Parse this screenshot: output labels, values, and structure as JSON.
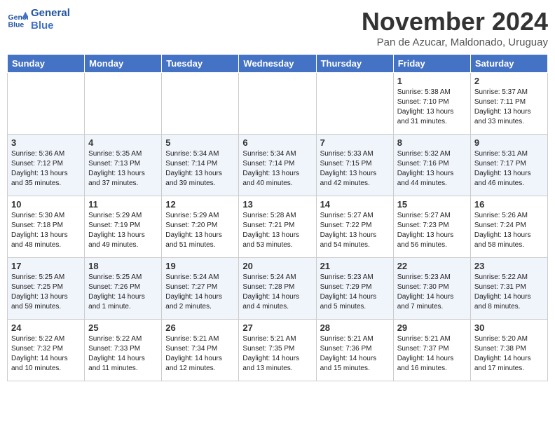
{
  "logo": {
    "text_general": "General",
    "text_blue": "Blue"
  },
  "header": {
    "month_title": "November 2024",
    "location": "Pan de Azucar, Maldonado, Uruguay"
  },
  "days_of_week": [
    "Sunday",
    "Monday",
    "Tuesday",
    "Wednesday",
    "Thursday",
    "Friday",
    "Saturday"
  ],
  "weeks": [
    [
      {
        "day": "",
        "info": ""
      },
      {
        "day": "",
        "info": ""
      },
      {
        "day": "",
        "info": ""
      },
      {
        "day": "",
        "info": ""
      },
      {
        "day": "",
        "info": ""
      },
      {
        "day": "1",
        "info": "Sunrise: 5:38 AM\nSunset: 7:10 PM\nDaylight: 13 hours\nand 31 minutes."
      },
      {
        "day": "2",
        "info": "Sunrise: 5:37 AM\nSunset: 7:11 PM\nDaylight: 13 hours\nand 33 minutes."
      }
    ],
    [
      {
        "day": "3",
        "info": "Sunrise: 5:36 AM\nSunset: 7:12 PM\nDaylight: 13 hours\nand 35 minutes."
      },
      {
        "day": "4",
        "info": "Sunrise: 5:35 AM\nSunset: 7:13 PM\nDaylight: 13 hours\nand 37 minutes."
      },
      {
        "day": "5",
        "info": "Sunrise: 5:34 AM\nSunset: 7:14 PM\nDaylight: 13 hours\nand 39 minutes."
      },
      {
        "day": "6",
        "info": "Sunrise: 5:34 AM\nSunset: 7:14 PM\nDaylight: 13 hours\nand 40 minutes."
      },
      {
        "day": "7",
        "info": "Sunrise: 5:33 AM\nSunset: 7:15 PM\nDaylight: 13 hours\nand 42 minutes."
      },
      {
        "day": "8",
        "info": "Sunrise: 5:32 AM\nSunset: 7:16 PM\nDaylight: 13 hours\nand 44 minutes."
      },
      {
        "day": "9",
        "info": "Sunrise: 5:31 AM\nSunset: 7:17 PM\nDaylight: 13 hours\nand 46 minutes."
      }
    ],
    [
      {
        "day": "10",
        "info": "Sunrise: 5:30 AM\nSunset: 7:18 PM\nDaylight: 13 hours\nand 48 minutes."
      },
      {
        "day": "11",
        "info": "Sunrise: 5:29 AM\nSunset: 7:19 PM\nDaylight: 13 hours\nand 49 minutes."
      },
      {
        "day": "12",
        "info": "Sunrise: 5:29 AM\nSunset: 7:20 PM\nDaylight: 13 hours\nand 51 minutes."
      },
      {
        "day": "13",
        "info": "Sunrise: 5:28 AM\nSunset: 7:21 PM\nDaylight: 13 hours\nand 53 minutes."
      },
      {
        "day": "14",
        "info": "Sunrise: 5:27 AM\nSunset: 7:22 PM\nDaylight: 13 hours\nand 54 minutes."
      },
      {
        "day": "15",
        "info": "Sunrise: 5:27 AM\nSunset: 7:23 PM\nDaylight: 13 hours\nand 56 minutes."
      },
      {
        "day": "16",
        "info": "Sunrise: 5:26 AM\nSunset: 7:24 PM\nDaylight: 13 hours\nand 58 minutes."
      }
    ],
    [
      {
        "day": "17",
        "info": "Sunrise: 5:25 AM\nSunset: 7:25 PM\nDaylight: 13 hours\nand 59 minutes."
      },
      {
        "day": "18",
        "info": "Sunrise: 5:25 AM\nSunset: 7:26 PM\nDaylight: 14 hours\nand 1 minute."
      },
      {
        "day": "19",
        "info": "Sunrise: 5:24 AM\nSunset: 7:27 PM\nDaylight: 14 hours\nand 2 minutes."
      },
      {
        "day": "20",
        "info": "Sunrise: 5:24 AM\nSunset: 7:28 PM\nDaylight: 14 hours\nand 4 minutes."
      },
      {
        "day": "21",
        "info": "Sunrise: 5:23 AM\nSunset: 7:29 PM\nDaylight: 14 hours\nand 5 minutes."
      },
      {
        "day": "22",
        "info": "Sunrise: 5:23 AM\nSunset: 7:30 PM\nDaylight: 14 hours\nand 7 minutes."
      },
      {
        "day": "23",
        "info": "Sunrise: 5:22 AM\nSunset: 7:31 PM\nDaylight: 14 hours\nand 8 minutes."
      }
    ],
    [
      {
        "day": "24",
        "info": "Sunrise: 5:22 AM\nSunset: 7:32 PM\nDaylight: 14 hours\nand 10 minutes."
      },
      {
        "day": "25",
        "info": "Sunrise: 5:22 AM\nSunset: 7:33 PM\nDaylight: 14 hours\nand 11 minutes."
      },
      {
        "day": "26",
        "info": "Sunrise: 5:21 AM\nSunset: 7:34 PM\nDaylight: 14 hours\nand 12 minutes."
      },
      {
        "day": "27",
        "info": "Sunrise: 5:21 AM\nSunset: 7:35 PM\nDaylight: 14 hours\nand 13 minutes."
      },
      {
        "day": "28",
        "info": "Sunrise: 5:21 AM\nSunset: 7:36 PM\nDaylight: 14 hours\nand 15 minutes."
      },
      {
        "day": "29",
        "info": "Sunrise: 5:21 AM\nSunset: 7:37 PM\nDaylight: 14 hours\nand 16 minutes."
      },
      {
        "day": "30",
        "info": "Sunrise: 5:20 AM\nSunset: 7:38 PM\nDaylight: 14 hours\nand 17 minutes."
      }
    ]
  ]
}
